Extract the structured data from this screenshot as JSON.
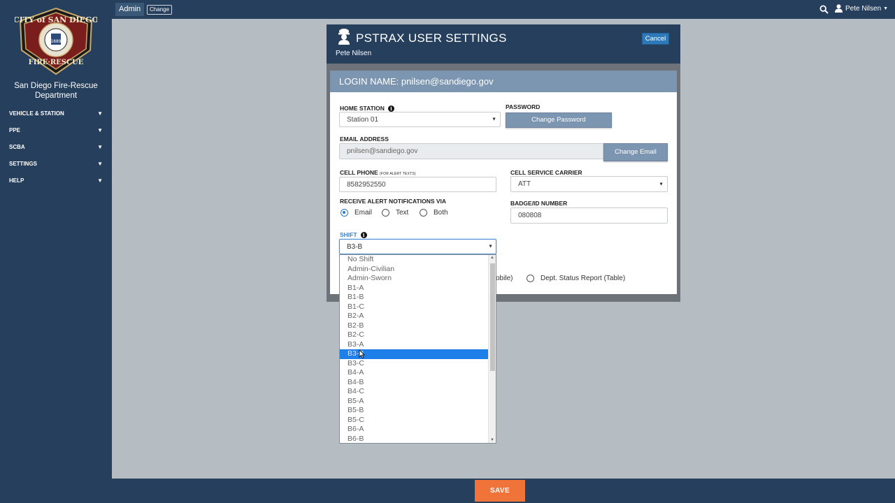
{
  "sidebar": {
    "logo": {
      "ring_top": "CITY of SAN DIEGO",
      "ring_bottom": "FIRE·RESCUE",
      "inner": "1889"
    },
    "dept_line1": "San Diego Fire-Rescue",
    "dept_line2": "Department",
    "items": [
      {
        "label": "VEHICLE & STATION",
        "icon": "chevron-down-icon"
      },
      {
        "label": "PPE",
        "icon": "chevron-down-icon"
      },
      {
        "label": "SCBA",
        "icon": "chevron-down-icon"
      },
      {
        "label": "SETTINGS",
        "icon": "chevron-down-icon"
      },
      {
        "label": "HELP",
        "icon": "chevron-down-icon"
      }
    ]
  },
  "topbar": {
    "role": "Admin",
    "change_label": "Change",
    "user_name": "Pete Nilsen",
    "search_icon": "search-icon",
    "user_icon": "user-icon"
  },
  "modal": {
    "title": "PSTRAX USER SETTINGS",
    "subtitle": "Pete Nilsen",
    "cancel_label": "Cancel",
    "login_label": "LOGIN NAME: pnilsen@sandiego.gov"
  },
  "form": {
    "home_station": {
      "label": "HOME STATION",
      "value": "Station 01"
    },
    "password": {
      "label": "PASSWORD",
      "button": "Change Password"
    },
    "email": {
      "label": "EMAIL ADDRESS",
      "value": "pnilsen@sandiego.gov",
      "button": "Change Email"
    },
    "cell_phone": {
      "label": "CELL PHONE",
      "hint": "(FOR ALERT TEXTS)",
      "value": "8582952550"
    },
    "carrier": {
      "label": "CELL SERVICE CARRIER",
      "value": "ATT"
    },
    "alerts": {
      "label": "RECEIVE ALERT NOTIFICATIONS VIA",
      "options": [
        "Email",
        "Text",
        "Both"
      ],
      "selected": "Email"
    },
    "badge": {
      "label": "BADGE/ID NUMBER",
      "value": "080808"
    },
    "shift": {
      "label": "SHIFT",
      "value": "B3-B",
      "options": [
        "No Shift",
        "Admin-Civilian",
        "Admin-Sworn",
        "B1-A",
        "B1-B",
        "B1-C",
        "B2-A",
        "B2-B",
        "B2-C",
        "B3-A",
        "B3-B",
        "B3-C",
        "B4-A",
        "B4-B",
        "B4-C",
        "B5-A",
        "B5-B",
        "B5-C",
        "B6-A",
        "B6-B"
      ],
      "highlighted_index": 10
    },
    "partial_text_1": "obile)",
    "partial_radio_label": "Dept. Status Report (Table)"
  },
  "footer": {
    "save_label": "SAVE"
  },
  "colors": {
    "navy": "#253f5c",
    "accent_blue": "#2e7ab8",
    "save_orange": "#f0733a",
    "slate": "#7c95b0"
  }
}
